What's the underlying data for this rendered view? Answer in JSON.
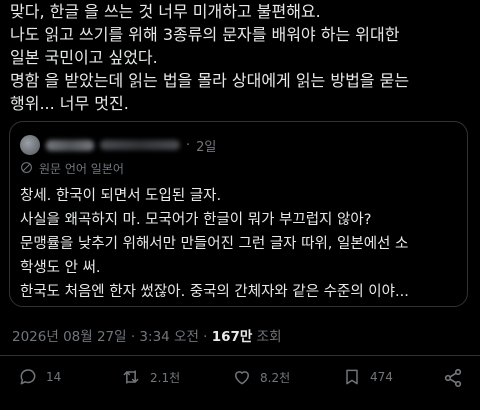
{
  "post": {
    "lines": [
      "맞다, 한글 을 쓰는 것 너무 미개하고 불편해요.",
      "나도 읽고 쓰기를 위해 3종류의 문자를 배워야 하는 위대한",
      "일본 국민이고 싶었다.",
      "명함 을 받았는데 읽는 법을 몰라 상대에게 읽는 방법을 묻는",
      "행위... 너무 멋진."
    ]
  },
  "quote": {
    "time": "2일",
    "translation_label": "원문 언어 일본어",
    "lines": [
      "창세. 한국이 되면서 도입된 글자.",
      "사실을 왜곡하지 마. 모국어가 한글이 뭐가 부끄럽지 않아?",
      "문맹률을 낮추기 위해서만 만들어진 그런 글자 따위, 일본에선 소",
      "학생도 안 써.",
      "한국도 처음엔 한자 썼잖아. 중국의 간체자와 같은 수준의 이야..."
    ]
  },
  "meta": {
    "timestamp": "2026년 08월 27일 · 3:34 오전 · ",
    "views_count": "167만",
    "views_label": " 조회"
  },
  "actions": {
    "replies": "14",
    "reposts": "2.1천",
    "likes": "8.2천",
    "bookmarks": "474"
  },
  "icons": [
    "reply-icon",
    "repost-icon",
    "like-icon",
    "bookmark-icon",
    "share-icon",
    "translate-icon"
  ],
  "colors": {
    "background": "#000000",
    "text": "#e7e9ea",
    "muted": "#71767b",
    "border": "#2f3336"
  }
}
